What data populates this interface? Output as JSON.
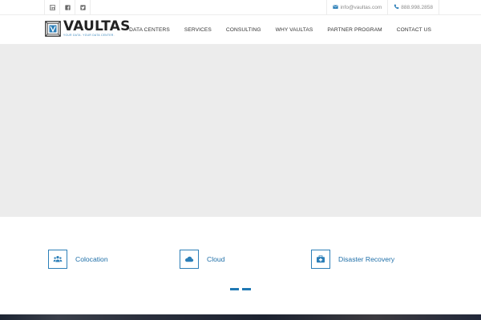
{
  "topbar": {
    "social": [
      {
        "icon": "linkedin-icon"
      },
      {
        "icon": "facebook-icon"
      },
      {
        "icon": "twitter-icon"
      }
    ],
    "email": "info@vaultas.com",
    "phone": "888.998.2858"
  },
  "header": {
    "logo_text": "VAULTAS",
    "logo_tagline": "your data. your data center.",
    "nav": [
      "DATA CENTERS",
      "SERVICES",
      "CONSULTING",
      "WHY VAULTAS",
      "PARTNER PROGRAM",
      "CONTACT US"
    ]
  },
  "services": [
    {
      "label": "Colocation",
      "icon": "users-icon"
    },
    {
      "label": "Cloud",
      "icon": "cloud-icon"
    },
    {
      "label": "Disaster Recovery",
      "icon": "medkit-icon"
    }
  ],
  "slider": {
    "dot_count": 2
  },
  "colors": {
    "accent": "#1f78b4",
    "hero_bg": "#ececec",
    "text": "#333333",
    "muted": "#8a8a8a"
  }
}
